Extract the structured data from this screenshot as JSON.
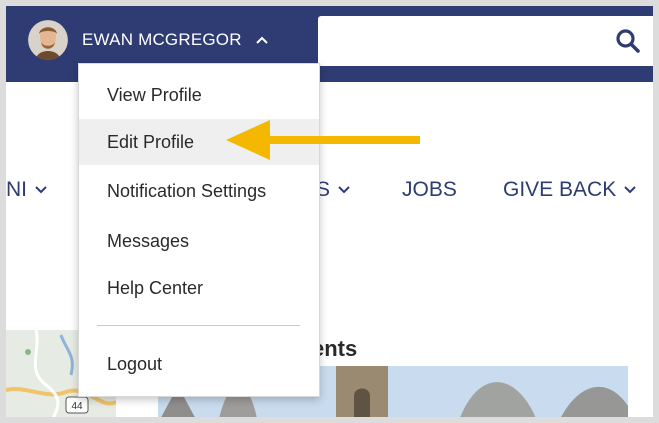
{
  "header": {
    "user_name": "EWAN MCGREGOR",
    "avatar_icon": "avatar-photo",
    "caret_icon": "chevron-up-icon",
    "search": {
      "placeholder": "",
      "value": "",
      "icon": "search-icon"
    },
    "brand_color": "#2e3c73"
  },
  "user_menu": {
    "items": [
      {
        "label": "View Profile"
      },
      {
        "label": "Edit Profile",
        "highlighted": true
      },
      {
        "label": "Notification Settings"
      },
      {
        "label": "Messages"
      },
      {
        "label": "Help Center"
      },
      {
        "label": "Logout"
      }
    ]
  },
  "nav": {
    "items": [
      {
        "label": "NI",
        "has_dropdown": true
      },
      {
        "label": "S",
        "has_dropdown": true
      },
      {
        "label": "JOBS",
        "has_dropdown": false
      },
      {
        "label": "GIVE BACK",
        "has_dropdown": true
      }
    ]
  },
  "content": {
    "section_title": "ents",
    "map_shield": "44"
  },
  "annotation": {
    "arrow_color": "#f5b800"
  }
}
